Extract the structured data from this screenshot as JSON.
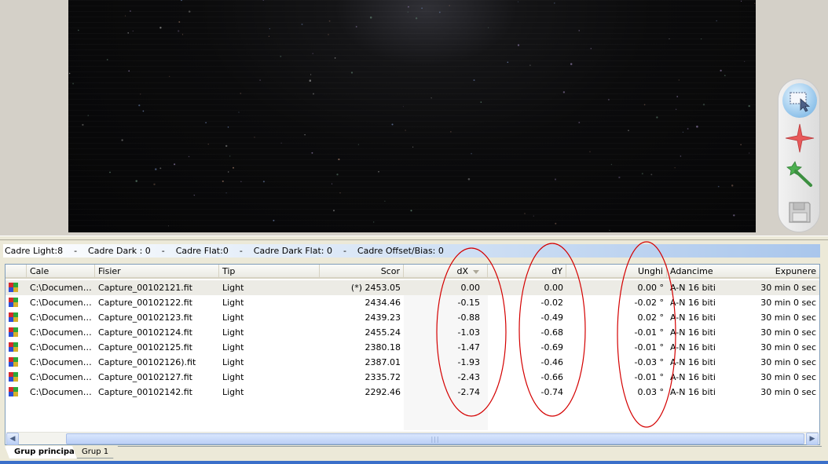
{
  "toolbar_icons": [
    "select-region-icon",
    "star-icon",
    "magic-wand-icon",
    "save-icon"
  ],
  "summary": "Cadre Light:8    -    Cadre Dark : 0    -    Cadre Flat:0    -    Cadre Dark Flat: 0    -    Cadre Offset/Bias: 0",
  "grid": {
    "columns": [
      "Cale",
      "Fisier",
      "Tip",
      "Scor",
      "dX",
      "dY",
      "Unghi",
      "Adancime",
      "Expunere"
    ],
    "rows": [
      {
        "cale": "C:\\Documents and Settings",
        "fisier": "Capture_00102121.fit",
        "tip": "Light",
        "scor": "(*) 2453.05",
        "dx": "0.00",
        "dy": "0.00",
        "unghi": "0.00 °",
        "adancime": "A-N 16 biti",
        "expunere": "30 min 0 sec"
      },
      {
        "cale": "C:\\Documents and Settings",
        "fisier": "Capture_00102122.fit",
        "tip": "Light",
        "scor": "2434.46",
        "dx": "-0.15",
        "dy": "-0.02",
        "unghi": "-0.02 °",
        "adancime": "A-N 16 biti",
        "expunere": "30 min 0 sec"
      },
      {
        "cale": "C:\\Documents and Settings",
        "fisier": "Capture_00102123.fit",
        "tip": "Light",
        "scor": "2439.23",
        "dx": "-0.88",
        "dy": "-0.49",
        "unghi": "0.02 °",
        "adancime": "A-N 16 biti",
        "expunere": "30 min 0 sec"
      },
      {
        "cale": "C:\\Documents and Settings",
        "fisier": "Capture_00102124.fit",
        "tip": "Light",
        "scor": "2455.24",
        "dx": "-1.03",
        "dy": "-0.68",
        "unghi": "-0.01 °",
        "adancime": "A-N 16 biti",
        "expunere": "30 min 0 sec"
      },
      {
        "cale": "C:\\Documents and Settings",
        "fisier": "Capture_00102125.fit",
        "tip": "Light",
        "scor": "2380.18",
        "dx": "-1.47",
        "dy": "-0.69",
        "unghi": "-0.01 °",
        "adancime": "A-N 16 biti",
        "expunere": "30 min 0 sec"
      },
      {
        "cale": "C:\\Documents and Settings",
        "fisier": "Capture_00102126).fit",
        "tip": "Light",
        "scor": "2387.01",
        "dx": "-1.93",
        "dy": "-0.46",
        "unghi": "-0.03 °",
        "adancime": "A-N 16 biti",
        "expunere": "30 min 0 sec"
      },
      {
        "cale": "C:\\Documents and Settings",
        "fisier": "Capture_00102127.fit",
        "tip": "Light",
        "scor": "2335.72",
        "dx": "-2.43",
        "dy": "-0.66",
        "unghi": "-0.01 °",
        "adancime": "A-N 16 biti",
        "expunere": "30 min 0 sec"
      },
      {
        "cale": "C:\\Documents and Settings",
        "fisier": "Capture_00102142.fit",
        "tip": "Light",
        "scor": "2292.46",
        "dx": "-2.74",
        "dy": "-0.74",
        "unghi": "0.03 °",
        "adancime": "A-N 16 biti",
        "expunere": "30 min 0 sec"
      }
    ]
  },
  "tabs": [
    "Grup principal",
    "Grup 1"
  ],
  "colors": {
    "annotation": "#d40000",
    "summary_bar": "#a9c6ec",
    "selected_row": "#ecebe5"
  }
}
